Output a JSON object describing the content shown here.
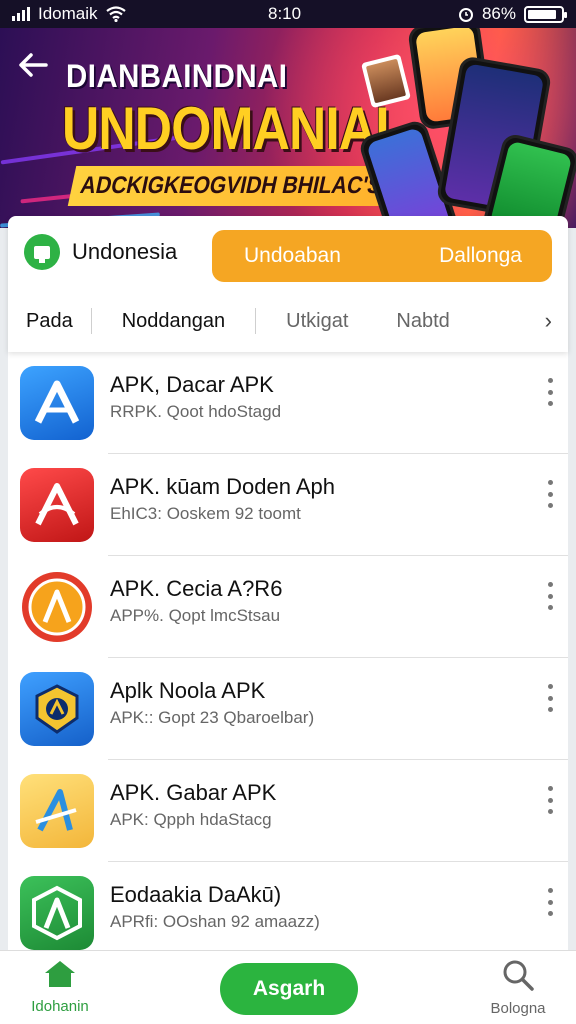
{
  "status_bar": {
    "carrier": "Idomaik",
    "time": "8:10",
    "battery": "86%",
    "battery_level": 0.86
  },
  "banner": {
    "title_line1": "DIANBAINDNAI",
    "title_line2": "UNDOMANIAI",
    "subtitle": "ADCKIGKEOGVIDH BHILAC'S?",
    "back_icon": "arrow-left-icon"
  },
  "region": {
    "label": "Undonesia",
    "icon": "monitor-icon"
  },
  "toggle": {
    "left_label": "Undoaban",
    "right_label": "Dallonga",
    "color": "#f5a623"
  },
  "tabs": [
    {
      "label": "Pada",
      "active": true
    },
    {
      "label": "Noddangan",
      "active": true
    },
    {
      "label": "Utkigat",
      "active": false
    },
    {
      "label": "Nabtd",
      "active": false
    }
  ],
  "apps": [
    {
      "title": "APK, Dacar APK",
      "subtitle": "RRPK. Qoot   hdoStagd",
      "icon_color": "#1d7fe0",
      "glyph": "A"
    },
    {
      "title": "APK. kūam Doden Aph",
      "subtitle": "EhIC3: Ooskem   92   toomt",
      "icon_color": "#d82a2a",
      "glyph": "A"
    },
    {
      "title": "APK. Cecia A?R6",
      "subtitle": "APP%. Qopt   lmcStsau",
      "icon_color": "#e94434",
      "glyph": "A"
    },
    {
      "title": "Aplk Noola APK",
      "subtitle": "APK:: Gopt 23   Qbaroelbar)",
      "icon_color": "#2b88e6",
      "glyph": "A"
    },
    {
      "title": "APK. Gabar APK",
      "subtitle": "APK:  Qpph   hdaStacg",
      "icon_color": "#f6c84a",
      "glyph": "A"
    },
    {
      "title": "Eodaakia DaAkū)",
      "subtitle": "APRfi: OOshan   92 amaazz)",
      "icon_color": "#2fa043",
      "glyph": "A"
    }
  ],
  "bottom_nav": {
    "home_label": "Idohanin",
    "home_icon": "home-icon",
    "search_button_label": "Asgarh",
    "right_label": "Bologna",
    "right_icon": "search-icon",
    "accent": "#2bb43f"
  }
}
